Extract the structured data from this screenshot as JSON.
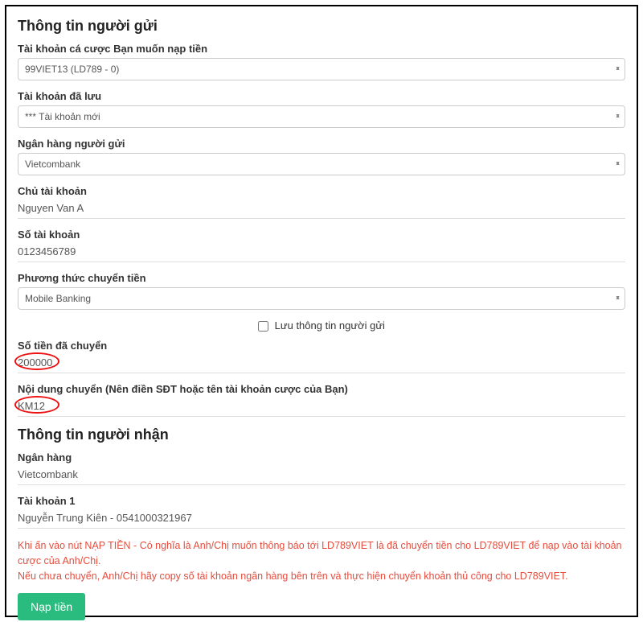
{
  "sender": {
    "title": "Thông tin người gửi",
    "account_label": "Tài khoản cá cược Bạn muốn nạp tiền",
    "account_value": "99VIET13 (LD789 - 0)",
    "saved_account_label": "Tài khoản đã lưu",
    "saved_account_value": "*** Tài khoản mới",
    "bank_label": "Ngân hàng người gửi",
    "bank_value": "Vietcombank",
    "owner_label": "Chủ tài khoản",
    "owner_value": "Nguyen Van A",
    "acc_number_label": "Số tài khoản",
    "acc_number_value": "0123456789",
    "method_label": "Phương thức chuyển tiền",
    "method_value": "Mobile Banking",
    "save_info_label": "Lưu thông tin người gửi",
    "amount_label": "Số tiền đã chuyển",
    "amount_value": "200000",
    "content_label": "Nội dung chuyển (Nên điền SĐT hoặc tên tài khoản cược của Bạn)",
    "content_value": "KM12"
  },
  "receiver": {
    "title": "Thông tin người nhận",
    "bank_label": "Ngân hàng",
    "bank_value": "Vietcombank",
    "acc1_label": "Tài khoản 1",
    "acc1_value": "Nguyễn Trung Kiên - 0541000321967"
  },
  "warning": {
    "line1": "Khi ấn vào nút NẠP TIỀN - Có nghĩa là Anh/Chị muốn thông báo tới LD789VIET là đã chuyển tiền cho LD789VIET để nạp vào tài khoản cược của Anh/Chị.",
    "line2": "Nếu chưa chuyển, Anh/Chị hãy copy số tài khoản ngân hàng bên trên và thực hiện chuyển khoản thủ công cho LD789VIET."
  },
  "submit_label": "Nạp tiền"
}
